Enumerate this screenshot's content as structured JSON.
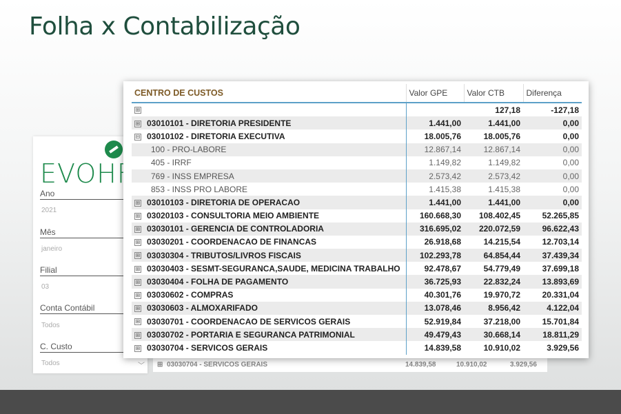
{
  "title": "Folha x Contabilização",
  "filters": {
    "logo_text": "EVOHF",
    "items": [
      {
        "label": "Ano",
        "value": "2021"
      },
      {
        "label": "Mês",
        "value": "janeiro"
      },
      {
        "label": "Filial",
        "value": "03"
      },
      {
        "label": "Conta Contábil",
        "value": "Todos"
      },
      {
        "label": "C. Custo",
        "value": "Todos"
      }
    ]
  },
  "ghost_row": {
    "name": "03030704 - SERVICOS GERAIS",
    "gpe": "14.839,58",
    "ctb": "10.910,02",
    "dif": "3.929,56"
  },
  "table": {
    "headers": {
      "name": "CENTRO DE CUSTOS",
      "gpe": "Valor GPE",
      "ctb": "Valor CTB",
      "dif": "Diferença"
    },
    "rows": [
      {
        "icon": "⊞",
        "name": "",
        "gpe": "",
        "ctb": "127,18",
        "dif": "-127,18"
      },
      {
        "icon": "⊞",
        "name": "03010101 - DIRETORIA PRESIDENTE",
        "gpe": "1.441,00",
        "ctb": "1.441,00",
        "dif": "0,00"
      },
      {
        "icon": "⊟",
        "name": "03010102 - DIRETORIA EXECUTIVA",
        "gpe": "18.005,76",
        "ctb": "18.005,76",
        "dif": "0,00"
      },
      {
        "icon": "",
        "name": "100 - PRO-LABORE",
        "gpe": "12.867,14",
        "ctb": "12.867,14",
        "dif": "0,00"
      },
      {
        "icon": "",
        "name": "405 - IRRF",
        "gpe": "1.149,82",
        "ctb": "1.149,82",
        "dif": "0,00"
      },
      {
        "icon": "",
        "name": "769 - INSS EMPRESA",
        "gpe": "2.573,42",
        "ctb": "2.573,42",
        "dif": "0,00"
      },
      {
        "icon": "",
        "name": "853 - INSS PRO LABORE",
        "gpe": "1.415,38",
        "ctb": "1.415,38",
        "dif": "0,00"
      },
      {
        "icon": "⊞",
        "name": "03010103 - DIRETORIA DE OPERACAO",
        "gpe": "1.441,00",
        "ctb": "1.441,00",
        "dif": "0,00"
      },
      {
        "icon": "⊞",
        "name": "03020103 - CONSULTORIA MEIO AMBIENTE",
        "gpe": "160.668,30",
        "ctb": "108.402,45",
        "dif": "52.265,85"
      },
      {
        "icon": "⊞",
        "name": "03030101 - GERENCIA DE CONTROLADORIA",
        "gpe": "316.695,02",
        "ctb": "220.072,59",
        "dif": "96.622,43"
      },
      {
        "icon": "⊞",
        "name": "03030201 - COORDENACAO DE FINANCAS",
        "gpe": "26.918,68",
        "ctb": "14.215,54",
        "dif": "12.703,14"
      },
      {
        "icon": "⊞",
        "name": "03030304 - TRIBUTOS/LIVROS FISCAIS",
        "gpe": "102.293,78",
        "ctb": "64.854,44",
        "dif": "37.439,34"
      },
      {
        "icon": "⊞",
        "name": "03030403 - SESMT-SEGURANCA,SAUDE, MEDICINA TRABALHO",
        "gpe": "92.478,67",
        "ctb": "54.779,49",
        "dif": "37.699,18"
      },
      {
        "icon": "⊞",
        "name": "03030404 - FOLHA DE PAGAMENTO",
        "gpe": "36.725,93",
        "ctb": "22.832,24",
        "dif": "13.893,69"
      },
      {
        "icon": "⊞",
        "name": "03030602 - COMPRAS",
        "gpe": "40.301,76",
        "ctb": "19.970,72",
        "dif": "20.331,04"
      },
      {
        "icon": "⊞",
        "name": "03030603 - ALMOXARIFADO",
        "gpe": "13.078,46",
        "ctb": "8.956,42",
        "dif": "4.122,04"
      },
      {
        "icon": "⊞",
        "name": "03030701 - COORDENACAO DE SERVICOS GERAIS",
        "gpe": "52.919,84",
        "ctb": "37.218,00",
        "dif": "15.701,84"
      },
      {
        "icon": "⊞",
        "name": "03030702 - PORTARIA E SEGURANCA PATRIMONIAL",
        "gpe": "49.479,43",
        "ctb": "30.668,14",
        "dif": "18.811,29"
      },
      {
        "icon": "⊞",
        "name": "03030704 - SERVICOS GERAIS",
        "gpe": "14.839,58",
        "ctb": "10.910,02",
        "dif": "3.929,56"
      }
    ]
  }
}
